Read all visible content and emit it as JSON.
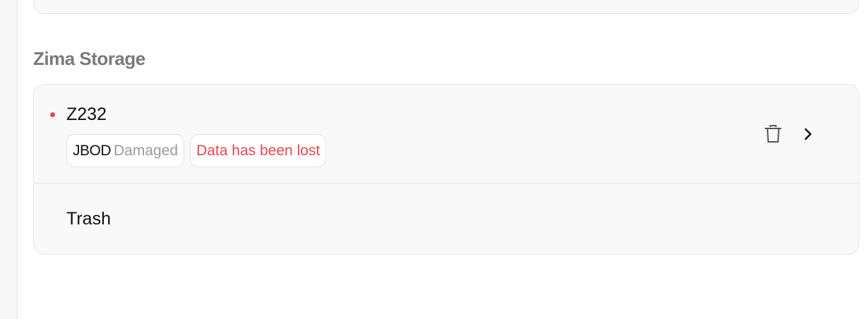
{
  "section": {
    "title": "Zima Storage"
  },
  "pools": [
    {
      "name": "Z232",
      "status_color": "#e5484d",
      "type": "JBOD",
      "health": "Damaged",
      "alert": "Data has been lost",
      "alert_color": "#e5484d"
    }
  ],
  "trash": {
    "label": "Trash",
    "icon": "trash-icon"
  },
  "icons": {
    "open": "chevron-right-icon"
  }
}
